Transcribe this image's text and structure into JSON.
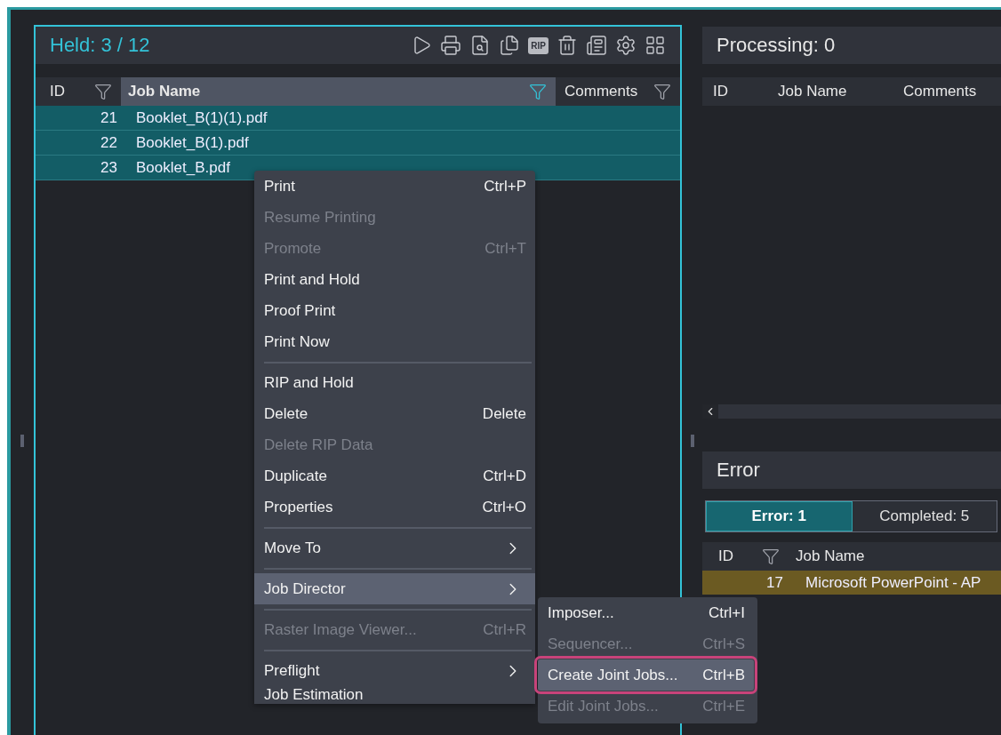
{
  "held": {
    "title": "Held: 3 / 12",
    "rip_label": "RIP",
    "columns": [
      {
        "label": "ID",
        "filter": true,
        "filter_active": false,
        "selected": false
      },
      {
        "label": "Job Name",
        "filter": true,
        "filter_active": true,
        "selected": true
      },
      {
        "label": "Comments",
        "filter": true,
        "filter_active": false,
        "selected": false
      }
    ],
    "rows": [
      {
        "id": "21",
        "name": "Booklet_B(1)(1).pdf",
        "selected": true
      },
      {
        "id": "22",
        "name": "Booklet_B(1).pdf",
        "selected": true
      },
      {
        "id": "23",
        "name": "Booklet_B.pdf",
        "selected": true
      }
    ]
  },
  "processing": {
    "title": "Processing: 0",
    "columns": [
      {
        "label": "ID"
      },
      {
        "label": "Job Name"
      },
      {
        "label": "Comments"
      }
    ]
  },
  "error": {
    "title": "Error",
    "tabs": [
      {
        "label": "Error: 1",
        "selected": true
      },
      {
        "label": "Completed: 5",
        "selected": false
      }
    ],
    "columns": [
      {
        "label": "ID",
        "filter": true
      },
      {
        "label": "Job Name",
        "filter": false
      }
    ],
    "rows": [
      {
        "id": "17",
        "name": "Microsoft PowerPoint - AP",
        "color": "#6b5a22"
      }
    ]
  },
  "context_menu": [
    {
      "kind": "item",
      "label": "Print",
      "shortcut": "Ctrl+P",
      "disabled": false,
      "submenu": false,
      "highlighted": false
    },
    {
      "kind": "item",
      "label": "Resume Printing",
      "disabled": true,
      "submenu": false,
      "highlighted": false
    },
    {
      "kind": "item",
      "label": "Promote",
      "shortcut": "Ctrl+T",
      "disabled": true,
      "submenu": false,
      "highlighted": false
    },
    {
      "kind": "item",
      "label": "Print and Hold",
      "disabled": false,
      "submenu": false,
      "highlighted": false
    },
    {
      "kind": "item",
      "label": "Proof Print",
      "disabled": false,
      "submenu": false,
      "highlighted": false
    },
    {
      "kind": "item",
      "label": "Print Now",
      "disabled": false,
      "submenu": false,
      "highlighted": false
    },
    {
      "kind": "separator"
    },
    {
      "kind": "item",
      "label": "RIP and Hold",
      "disabled": false,
      "submenu": false,
      "highlighted": false
    },
    {
      "kind": "item",
      "label": "Delete",
      "shortcut": "Delete",
      "disabled": false,
      "submenu": false,
      "highlighted": false
    },
    {
      "kind": "item",
      "label": "Delete RIP Data",
      "disabled": true,
      "submenu": false,
      "highlighted": false
    },
    {
      "kind": "item",
      "label": "Duplicate",
      "shortcut": "Ctrl+D",
      "disabled": false,
      "submenu": false,
      "highlighted": false
    },
    {
      "kind": "item",
      "label": "Properties",
      "shortcut": "Ctrl+O",
      "disabled": false,
      "submenu": false,
      "highlighted": false
    },
    {
      "kind": "separator"
    },
    {
      "kind": "item",
      "label": "Move To",
      "disabled": false,
      "submenu": true,
      "highlighted": false
    },
    {
      "kind": "separator"
    },
    {
      "kind": "item",
      "label": "Job Director",
      "disabled": false,
      "submenu": true,
      "highlighted": true
    },
    {
      "kind": "separator"
    },
    {
      "kind": "item",
      "label": "Raster Image Viewer...",
      "shortcut": "Ctrl+R",
      "disabled": true,
      "submenu": false,
      "highlighted": false
    },
    {
      "kind": "separator"
    },
    {
      "kind": "item",
      "label": "Preflight",
      "disabled": false,
      "submenu": true,
      "highlighted": false
    },
    {
      "kind": "item",
      "label": "Job Estimation",
      "disabled": false,
      "submenu": false,
      "highlighted": false
    }
  ],
  "submenu": [
    {
      "label": "Imposer...",
      "shortcut": "Ctrl+I",
      "disabled": false,
      "highlighted": false
    },
    {
      "label": "Sequencer...",
      "shortcut": "Ctrl+S",
      "disabled": true,
      "highlighted": false
    },
    {
      "label": "Create Joint Jobs...",
      "shortcut": "Ctrl+B",
      "disabled": false,
      "highlighted": true
    },
    {
      "label": "Edit Joint Jobs...",
      "shortcut": "Ctrl+E",
      "disabled": true,
      "highlighted": false
    }
  ]
}
